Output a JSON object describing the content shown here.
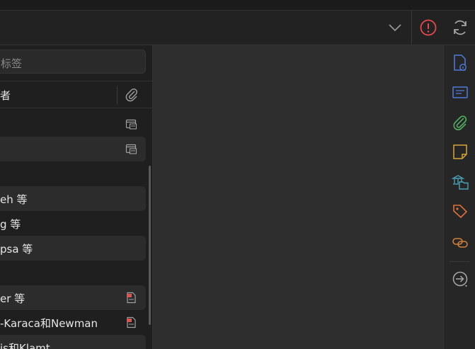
{
  "search": {
    "placeholder": "标签"
  },
  "column_header": {
    "title": "者"
  },
  "rows": [
    {
      "text": "",
      "icon": "web-snapshot-icon"
    },
    {
      "text": "",
      "icon": "web-snapshot-icon"
    },
    {
      "text": "",
      "icon": ""
    },
    {
      "text": "eh 等",
      "icon": ""
    },
    {
      "text": "g 等",
      "icon": ""
    },
    {
      "text": "psa 等",
      "icon": ""
    },
    {
      "text": "",
      "icon": ""
    },
    {
      "text": "er 等",
      "icon": "pdf-icon"
    },
    {
      "text": "-Karaca和Newman",
      "icon": "pdf-icon"
    },
    {
      "text": "is和Klamt",
      "icon": ""
    }
  ],
  "toolbar_icons": [
    "chevron-down-icon",
    "alert-icon",
    "sync-icon"
  ],
  "side_rail_icons": [
    "info-icon",
    "abstract-icon",
    "attachments-icon",
    "notes-icon",
    "libraries-collections-icon",
    "tags-icon",
    "related-icon",
    "locate-icon"
  ],
  "colors": {
    "alert": "#e5484d",
    "info": "#4f7bd9",
    "abstract": "#4f7bd9",
    "attachments": "#4fae5f",
    "notes": "#d9a53a",
    "libraries": "#4aa3b8",
    "tags": "#e0703a",
    "related": "#d0803a",
    "pdf": "#e25050"
  }
}
